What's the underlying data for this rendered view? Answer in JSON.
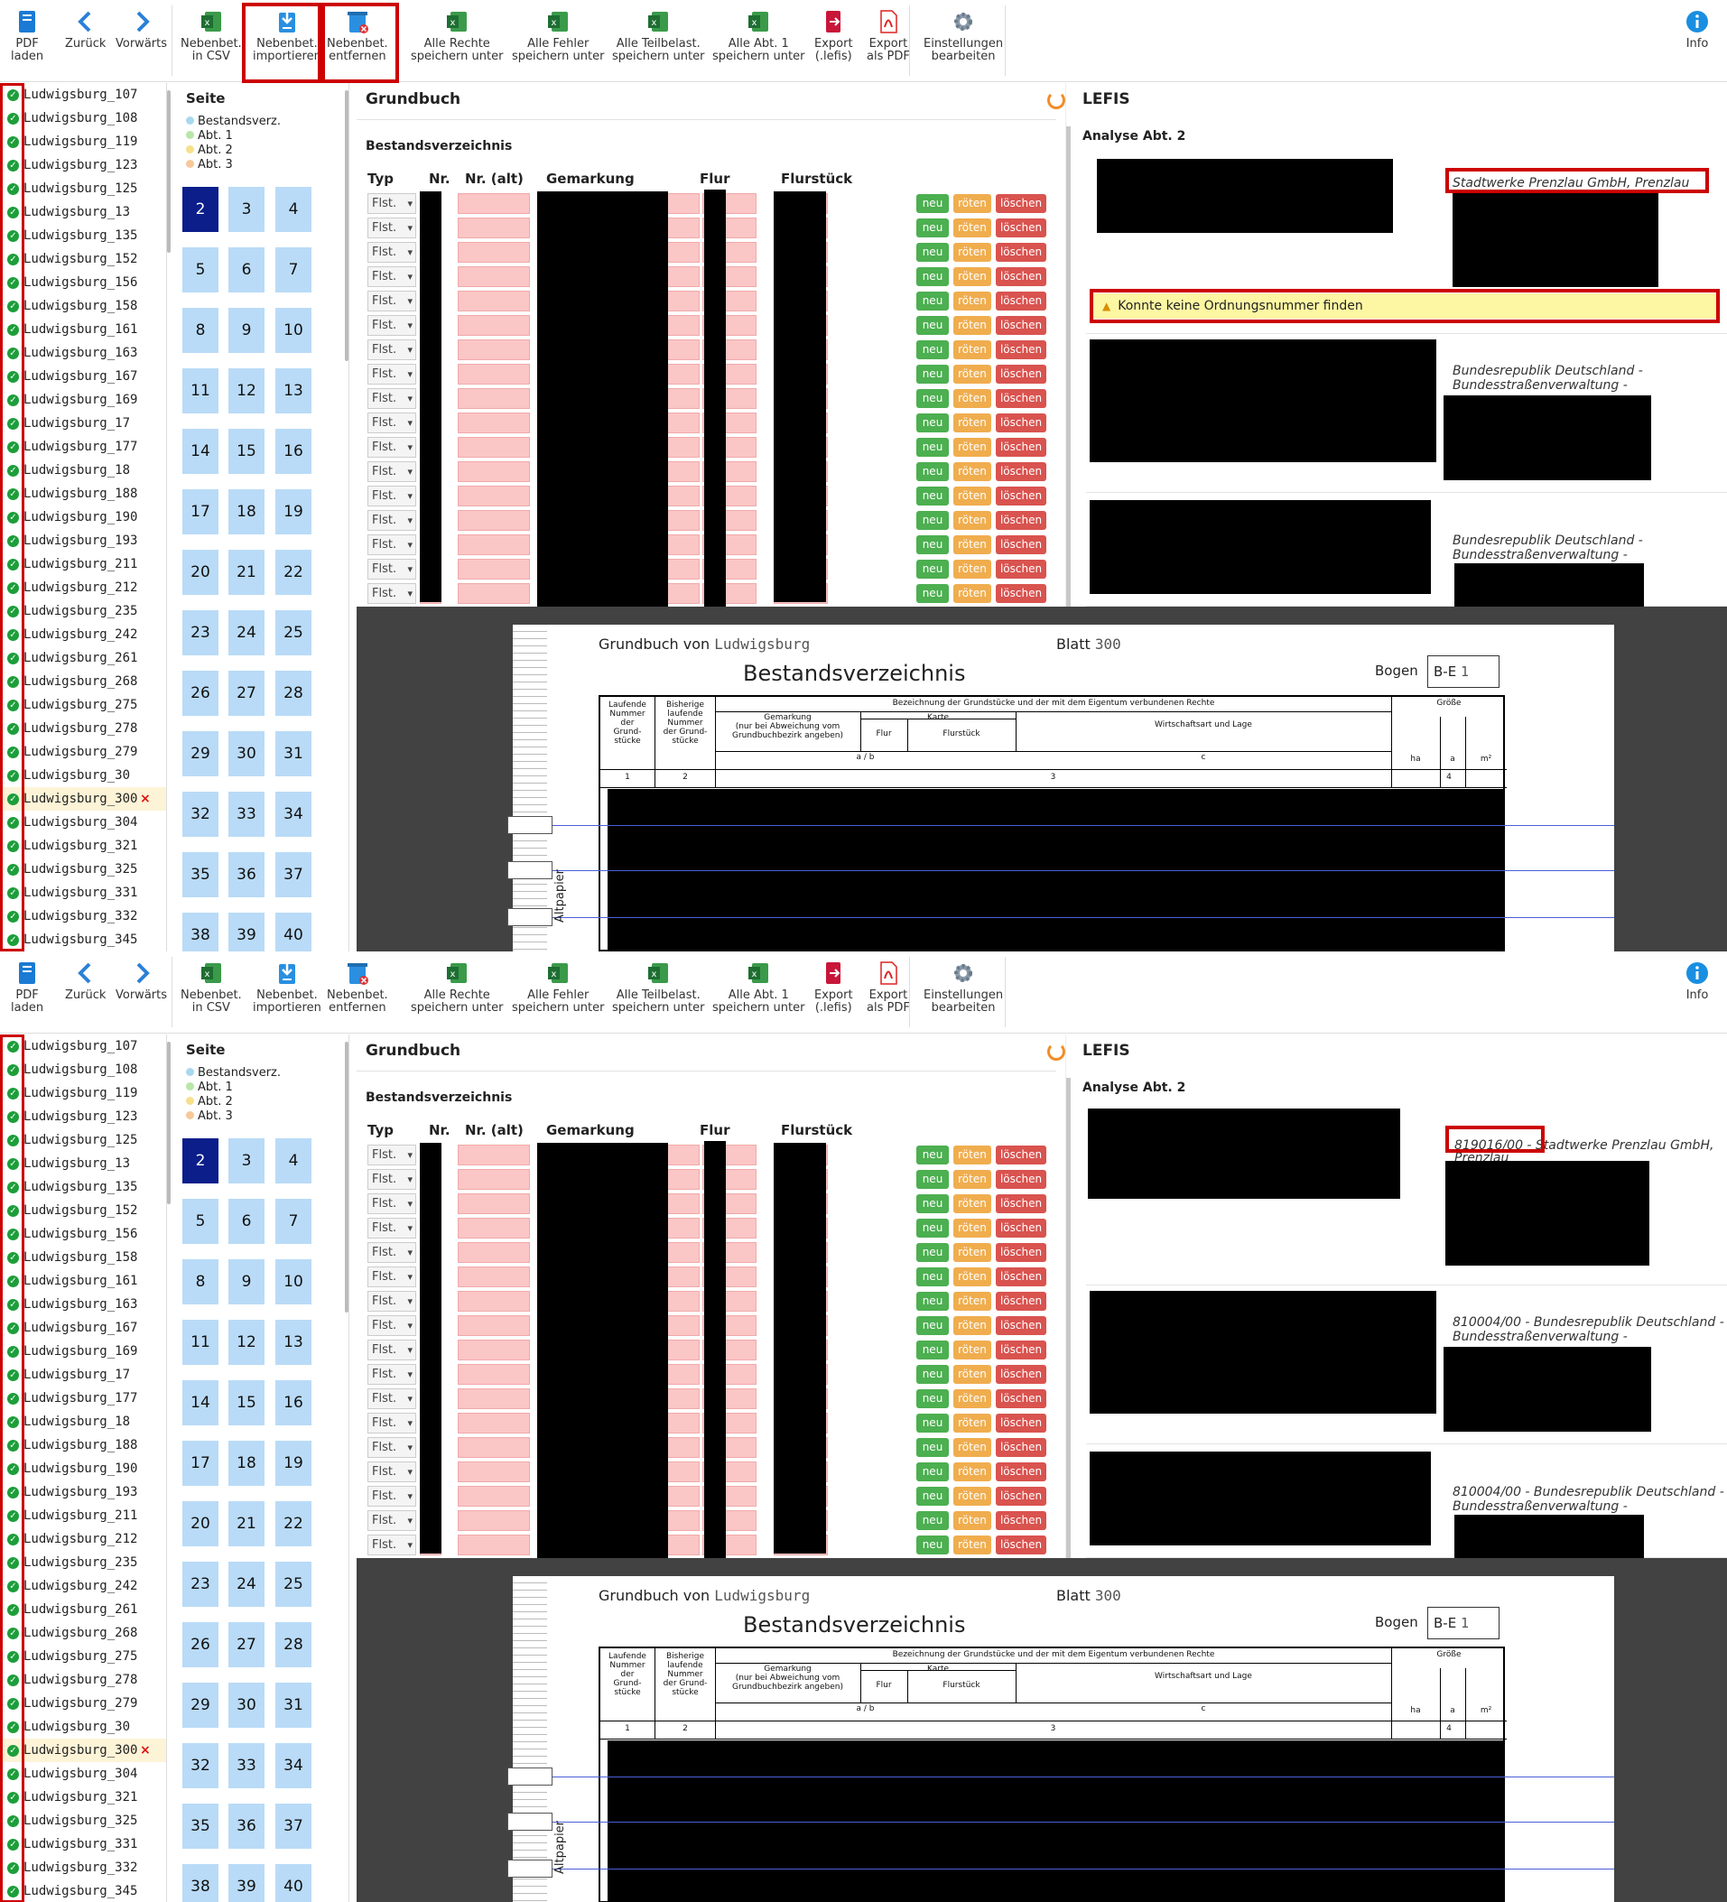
{
  "toolbar": {
    "buttons": [
      {
        "label": "PDF\nladen",
        "icon": "pdf-load-icon"
      },
      {
        "label": "Zurück",
        "icon": "arrow-left-icon"
      },
      {
        "label": "Vorwärts",
        "icon": "arrow-right-icon"
      },
      {
        "label": "Nebenbet.\nin CSV",
        "icon": "excel-icon"
      },
      {
        "label": "Nebenbet.\nimportieren",
        "icon": "import-icon"
      },
      {
        "label": "Nebenbet.\nentfernen",
        "icon": "remove-icon"
      },
      {
        "label": "Alle Rechte\nspeichern unter",
        "icon": "excel-icon"
      },
      {
        "label": "Alle Fehler\nspeichern unter",
        "icon": "excel-icon"
      },
      {
        "label": "Alle Teilbelast.\nspeichern unter",
        "icon": "excel-icon"
      },
      {
        "label": "Alle Abt. 1\nspeichern unter",
        "icon": "excel-icon"
      },
      {
        "label": "Export\n(.lefis)",
        "icon": "export-lefis-icon"
      },
      {
        "label": "Export\nals PDF",
        "icon": "pdf-export-icon"
      },
      {
        "label": "Einstellungen\nbearbeiten",
        "icon": "gear-icon"
      },
      {
        "label": "Info",
        "icon": "info-icon"
      }
    ]
  },
  "files": [
    "Ludwigsburg_107",
    "Ludwigsburg_108",
    "Ludwigsburg_119",
    "Ludwigsburg_123",
    "Ludwigsburg_125",
    "Ludwigsburg_13",
    "Ludwigsburg_135",
    "Ludwigsburg_152",
    "Ludwigsburg_156",
    "Ludwigsburg_158",
    "Ludwigsburg_161",
    "Ludwigsburg_163",
    "Ludwigsburg_167",
    "Ludwigsburg_169",
    "Ludwigsburg_17",
    "Ludwigsburg_177",
    "Ludwigsburg_18",
    "Ludwigsburg_188",
    "Ludwigsburg_190",
    "Ludwigsburg_193",
    "Ludwigsburg_211",
    "Ludwigsburg_212",
    "Ludwigsburg_235",
    "Ludwigsburg_242",
    "Ludwigsburg_261",
    "Ludwigsburg_268",
    "Ludwigsburg_275",
    "Ludwigsburg_278",
    "Ludwigsburg_279",
    "Ludwigsburg_30",
    "Ludwigsburg_300",
    "Ludwigsburg_304",
    "Ludwigsburg_321",
    "Ludwigsburg_325",
    "Ludwigsburg_331",
    "Ludwigsburg_332",
    "Ludwigsburg_345"
  ],
  "selected_file": "Ludwigsburg_300",
  "status_ok_icon": "check-circle-icon",
  "status_error_icon": "x-icon",
  "pages": {
    "title": "Seite",
    "legend": [
      {
        "label": "Bestandsverz.",
        "color": "#a8d8f0"
      },
      {
        "label": "Abt. 1",
        "color": "#b8e6a8"
      },
      {
        "label": "Abt. 2",
        "color": "#f6e08a"
      },
      {
        "label": "Abt. 3",
        "color": "#f6c89a"
      }
    ],
    "numbers": [
      "2",
      "3",
      "4",
      "5",
      "6",
      "7",
      "8",
      "9",
      "10",
      "11",
      "12",
      "13",
      "14",
      "15",
      "16",
      "17",
      "18",
      "19",
      "20",
      "21",
      "22",
      "23",
      "24",
      "25",
      "26",
      "27",
      "28",
      "29",
      "30",
      "31",
      "32",
      "33",
      "34",
      "35",
      "36",
      "37",
      "38",
      "39",
      "40"
    ],
    "current": "2"
  },
  "grundbuch": {
    "title": "Grundbuch",
    "section": "Bestandsverzeichnis",
    "columns": [
      "Typ",
      "Nr.",
      "Nr. (alt)",
      "Gemarkung",
      "Flur",
      "Flurstück"
    ],
    "row_type": "Flst.",
    "row_count": 17,
    "btn_new": "neu",
    "btn_red": "röten",
    "btn_delete": "löschen"
  },
  "lefis": {
    "title": "LEFIS",
    "analyse": "Analyse Abt. 2"
  },
  "panel_before": {
    "card1_owner": "Stadtwerke Prenzlau GmbH, Prenzlau",
    "warning": "Konnte keine Ordnungsnummer finden",
    "card2_owner": [
      "Bundesrepublik Deutschland -",
      "Bundesstraßenverwaltung -"
    ],
    "card3_owner": [
      "Bundesrepublik Deutschland -",
      "Bundesstraßenverwaltung -"
    ]
  },
  "panel_after": {
    "card1_owner": [
      "819016/00 - Stadtwerke Prenzlau GmbH,",
      "Prenzlau"
    ],
    "card2_owner": [
      "810004/00 - Bundesrepublik Deutschland -",
      "Bundesstraßenverwaltung -"
    ],
    "card3_owner": [
      "810004/00 - Bundesrepublik Deutschland -",
      "Bundesstraßenverwaltung -"
    ]
  },
  "document": {
    "grundbuch_von_label": "Grundbuch von",
    "grundbuch_von_value": "Ludwigsburg",
    "blatt_label": "Blatt",
    "blatt_value": "300",
    "heading": "Bestandsverzeichnis",
    "bogen_label": "Bogen",
    "bogen_value": "B-E",
    "bogen_num": "1",
    "col_lfd": "Laufende\nNummer\nder\nGrund-\nstücke",
    "col_bisherige": "Bisherige\nlaufende\nNummer\nder Grund-\nstücke",
    "col_bezeichnung": "Bezeichnung der Grundstücke und der mit dem Eigentum verbundenen Rechte",
    "col_gemarkung": "Gemarkung\n(nur bei Abweichung vom\nGrundbuchbezirk angeben)",
    "col_karte": "Karte",
    "col_flur": "Flur",
    "col_flurstueck": "Flurstück",
    "col_wirtschaft": "Wirtschaftsart und Lage",
    "col_groesse": "Größe",
    "sub_ab": "a / b",
    "sub_c": "c",
    "unit_ha": "ha",
    "unit_a": "a",
    "unit_m2": "m²",
    "num_1": "1",
    "num_2": "2",
    "num_3": "3",
    "num_4": "4",
    "altpapier": "Altpapier"
  }
}
